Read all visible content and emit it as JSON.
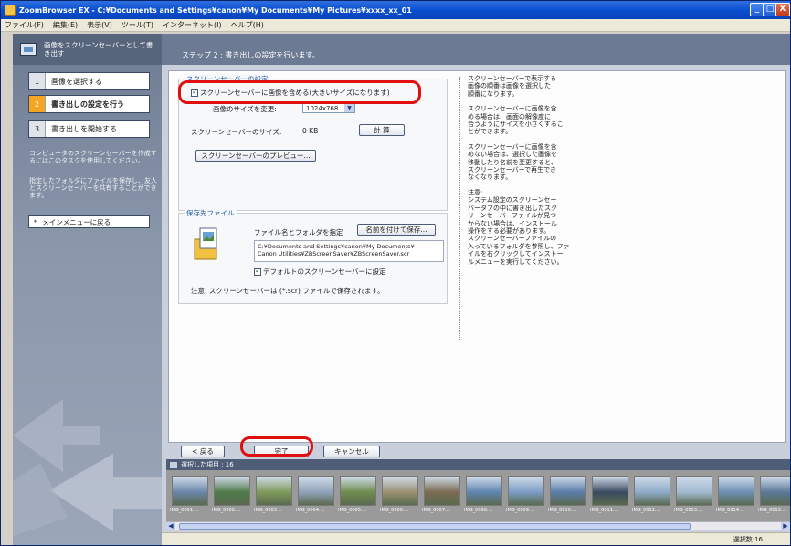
{
  "window": {
    "title": "ZoomBrowser EX  -  C:¥Documents and Settings¥canon¥My Documents¥My Pictures¥xxxx_xx_01",
    "controls": [
      "_",
      "□",
      "X"
    ]
  },
  "menu": [
    "ファイル(F)",
    "編集(E)",
    "表示(V)",
    "ツール(T)",
    "インターネット(I)",
    "ヘルプ(H)"
  ],
  "sidebar": {
    "header": "画像をスクリーンセーバーとして書き出す",
    "steps": [
      {
        "num": "1",
        "label": "画像を選択する"
      },
      {
        "num": "2",
        "label": "書き出しの設定を行う"
      },
      {
        "num": "3",
        "label": "書き出しを開始する"
      }
    ],
    "note1": "コンピュータのスクリーンセーバーを作成するにはこのタスクを使用してください。",
    "note2": "指定したフォルダにファイルを保存し、友人とスクリーンセーバーを共有することができます。",
    "back_button": "メインメニューに戻る",
    "back_icon": "return-arrow-icon"
  },
  "main": {
    "header": "ステップ 2 : 書き出しの設定を行います。",
    "screensaver_group": {
      "title": "スクリーンセーバーの設定",
      "include_images_label": "スクリーンセーバーに画像を含める(大きいサイズになります)",
      "include_images_checked": true,
      "resize_label": "画像のサイズを変更:",
      "resize_value": "1024x768",
      "size_label": "スクリーンセーバーのサイズ:",
      "size_value": "0 KB",
      "calc_button": "計 算",
      "preview_button": "スクリーンセーバーのプレビュー..."
    },
    "save_group": {
      "title": "保存先ファイル",
      "filename_label": "ファイル名とフォルダを指定",
      "save_as_button": "名前を付けて保存...",
      "path_line1": "C:¥Documents and Settings¥canon¥My Documents¥",
      "path_line2": "Canon Utilities¥ZBScreenSaver¥ZBScreenSaver.scr",
      "default_label": "デフォルトのスクリーンセーバーに設定",
      "default_checked": true,
      "note": "注意: スクリーンセーバーは (*.scr) ファイルで保存されます。"
    },
    "side_notes": [
      "スクリーンセーバーで表示する\n画像の順番は画像を選択した\n順番になります。",
      "スクリーンセーバーに画像を含\nめる場合は、画面の解像度に\n合うようにサイズを小さくするこ\nとができます。",
      "スクリーンセーバーに画像を含\nめない場合は、選択した画像を\n移動したり名前を変更すると、\nスクリーンセーバーで再生でき\nなくなります。",
      "注意:\nシステム設定のスクリーンセー\nバータブの中に書き出したスク\nリーンセーバーファイルが見つ\nからない場合は、インストール\n操作をする必要があります。\nスクリーンセーバーファイルの\n入っているフォルダを参照し、ファ\nイルを右クリックしてインストー\nルメニューを実行してください。"
    ],
    "nav": {
      "back": "< 戻る",
      "finish": "完了",
      "cancel": "キャンセル"
    }
  },
  "thumbs": {
    "header": "選択した項目 : 16",
    "items": [
      {
        "cap": "IMG_0001....",
        "color": "#6a86a8"
      },
      {
        "cap": "IMG_0002....",
        "color": "#4f7a4a"
      },
      {
        "cap": "IMG_0003....",
        "color": "#7e9a5a"
      },
      {
        "cap": "IMG_0004....",
        "color": "#8fa2b8"
      },
      {
        "cap": "IMG_0005....",
        "color": "#6e8c4e"
      },
      {
        "cap": "IMG_0006....",
        "color": "#9a9070"
      },
      {
        "cap": "IMG_0007....",
        "color": "#7a6a50"
      },
      {
        "cap": "IMG_0008....",
        "color": "#5e84b0"
      },
      {
        "cap": "IMG_0009....",
        "color": "#7b9cc4"
      },
      {
        "cap": "IMG_0010....",
        "color": "#5a7da8"
      },
      {
        "cap": "IMG_0011....",
        "color": "#3a4a60"
      },
      {
        "cap": "IMG_0012....",
        "color": "#8eaac8"
      },
      {
        "cap": "IMG_0013....",
        "color": "#a2bad2"
      },
      {
        "cap": "IMG_0014....",
        "color": "#6c8fb4"
      },
      {
        "cap": "IMG_0015....",
        "color": "#5a7898"
      }
    ]
  },
  "status": {
    "selected": "選択数:16"
  },
  "colors": {
    "highlight": "#e01010",
    "accent_step": "#f4a623"
  }
}
